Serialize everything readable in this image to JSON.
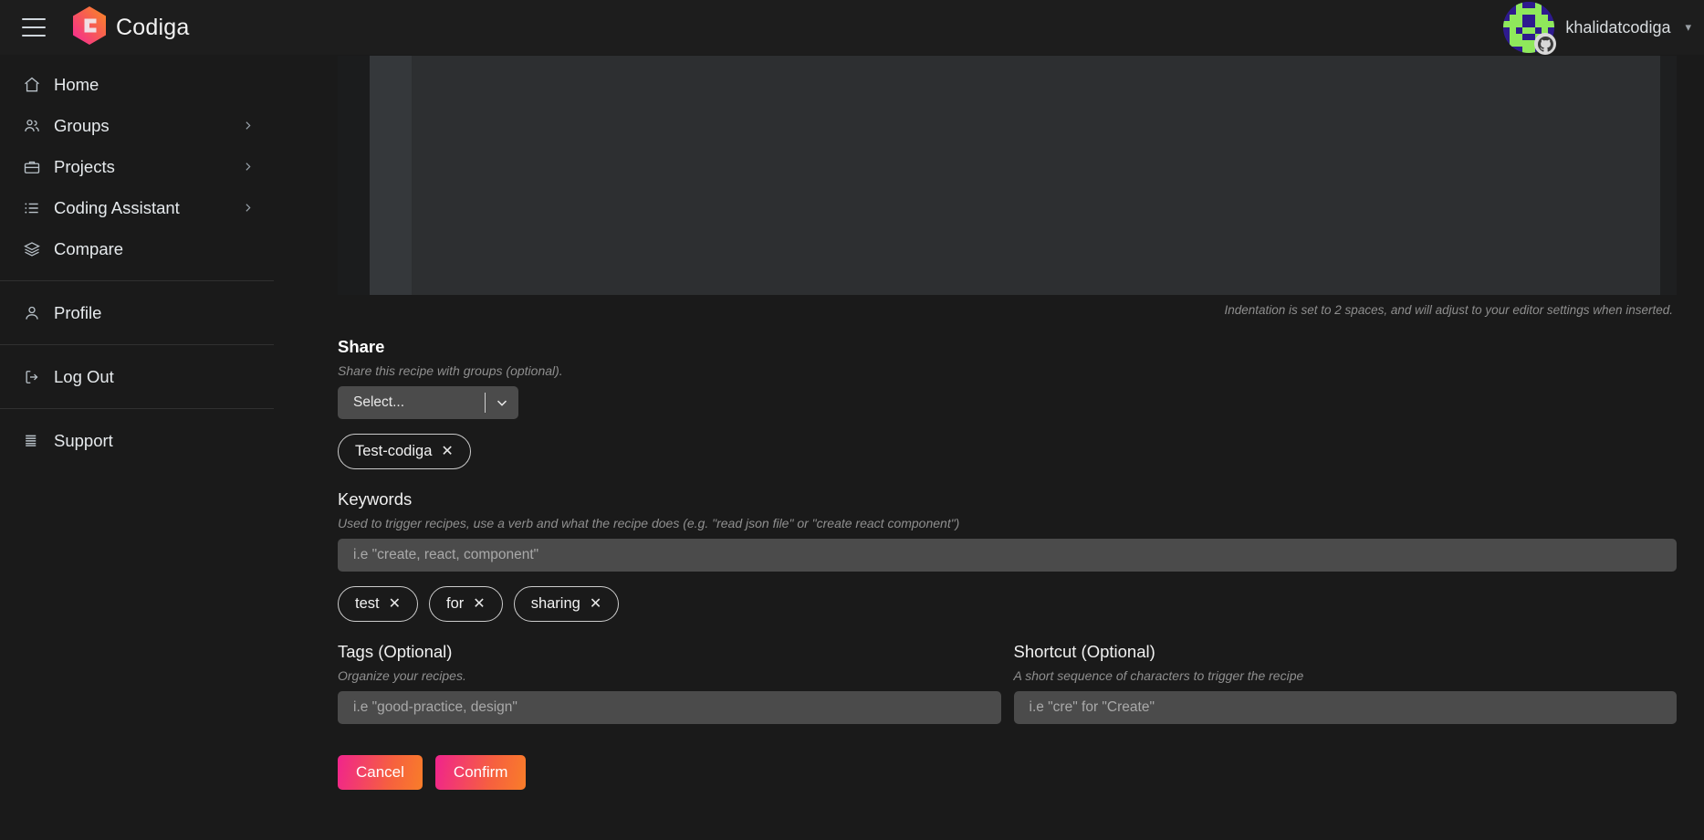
{
  "topbar": {
    "menu_icon": "hamburger-icon",
    "brand_name": "Codiga",
    "brand_logo_icon": "codiga-hexagon-logo",
    "username": "khalidatcodiga",
    "caret_icon": "chevron-down-icon",
    "avatar_icon": "user-identicon-avatar",
    "provider_badge_icon": "github-icon"
  },
  "sidebar": {
    "items": [
      {
        "label": "Home",
        "icon": "home-icon",
        "has_chevron": false
      },
      {
        "label": "Groups",
        "icon": "groups-icon",
        "has_chevron": true
      },
      {
        "label": "Projects",
        "icon": "briefcase-icon",
        "has_chevron": true
      },
      {
        "label": "Coding Assistant",
        "icon": "list-icon",
        "has_chevron": true
      },
      {
        "label": "Compare",
        "icon": "layers-icon",
        "has_chevron": false
      },
      {
        "label": "Profile",
        "icon": "person-icon",
        "has_chevron": false
      },
      {
        "label": "Log Out",
        "icon": "logout-icon",
        "has_chevron": false
      },
      {
        "label": "Support",
        "icon": "support-menu-icon",
        "has_chevron": false
      }
    ]
  },
  "main": {
    "indent_note": "Indentation is set to 2 spaces, and will adjust to your editor settings when inserted.",
    "share": {
      "title": "Share",
      "helper": "Share this recipe with groups (optional).",
      "select_value": "Select...",
      "select_chevron_icon": "chevron-down-icon",
      "chips": [
        {
          "label": "Test-codiga",
          "remove_icon": "close-icon"
        }
      ]
    },
    "keywords": {
      "title": "Keywords",
      "helper": "Used to trigger recipes, use a verb and what the recipe does (e.g. \"read json file\" or \"create react component\")",
      "placeholder": "i.e \"create, react, component\"",
      "value": "",
      "chips": [
        {
          "label": "test",
          "remove_icon": "close-icon"
        },
        {
          "label": "for",
          "remove_icon": "close-icon"
        },
        {
          "label": "sharing",
          "remove_icon": "close-icon"
        }
      ]
    },
    "tags": {
      "title": "Tags (Optional)",
      "helper": "Organize your recipes.",
      "placeholder": "i.e \"good-practice, design\"",
      "value": ""
    },
    "shortcut": {
      "title": "Shortcut (Optional)",
      "helper": "A short sequence of characters to trigger the recipe",
      "placeholder": "i.e \"cre\" for \"Create\"",
      "value": ""
    },
    "buttons": {
      "cancel": "Cancel",
      "confirm": "Confirm"
    }
  },
  "colors": {
    "accent_pink": "#f0248c",
    "accent_orange": "#f97d29",
    "page_bg": "#1a1a1a",
    "input_bg": "#4b4b4b",
    "editor_bg": "#2d2f31"
  }
}
